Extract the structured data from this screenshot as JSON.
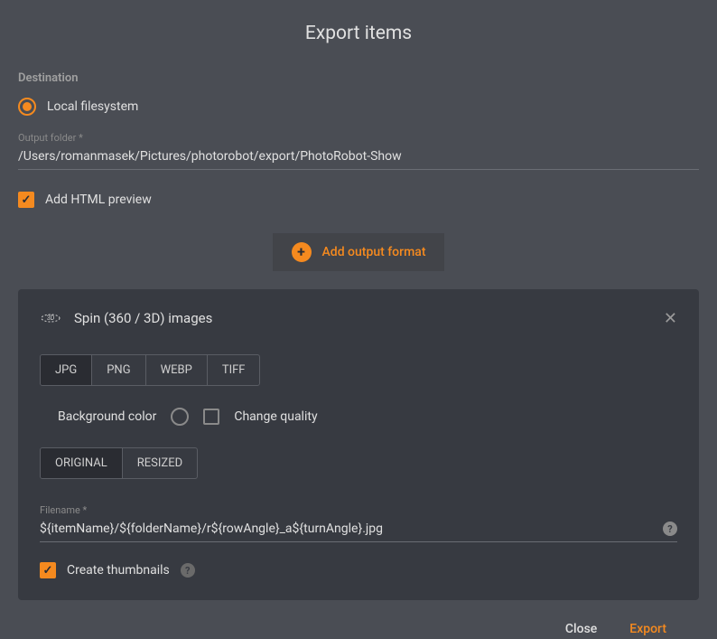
{
  "title": "Export items",
  "destination": {
    "label": "Destination",
    "option": "Local filesystem",
    "outputFolderLabel": "Output folder *",
    "outputFolder": "/Users/romanmasek/Pictures/photorobot/export/PhotoRobot-Show",
    "addHtmlPreview": "Add HTML preview"
  },
  "addFormat": "Add output format",
  "panel": {
    "title": "Spin (360 / 3D) images",
    "formats": [
      "JPG",
      "PNG",
      "WEBP",
      "TIFF"
    ],
    "bgColorLabel": "Background color",
    "changeQualityLabel": "Change quality",
    "sizeOptions": [
      "ORIGINAL",
      "RESIZED"
    ],
    "filenameLabel": "Filename *",
    "filename": "${itemName}/${folderName}/r${rowAngle}_a${turnAngle}.jpg",
    "createThumbs": "Create thumbnails"
  },
  "footer": {
    "close": "Close",
    "export": "Export"
  }
}
